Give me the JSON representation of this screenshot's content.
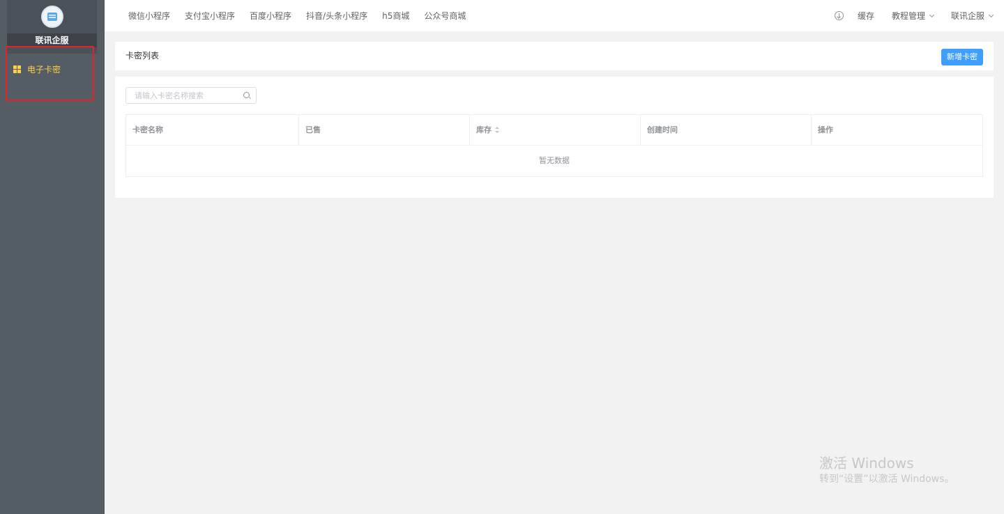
{
  "sidebar": {
    "brand_name": "联讯企服",
    "menu": [
      {
        "label": "电子卡密",
        "icon": "grid-icon",
        "active": true,
        "color": "#ffd04b"
      }
    ],
    "background": "#545c64",
    "highlight_color": "#e8202a"
  },
  "topnav": {
    "items": [
      "微信小程序",
      "支付宝小程序",
      "百度小程序",
      "抖音/头条小程序",
      "h5商城",
      "公众号商城"
    ],
    "right": {
      "download_icon": "download-circle-icon",
      "cache": "缓存",
      "tutorial": "教程管理",
      "user": "联讯企服"
    }
  },
  "card": {
    "title": "卡密列表",
    "add_button": "新增卡密",
    "search": {
      "placeholder": "请输入卡密名称搜索",
      "value": ""
    },
    "table": {
      "columns": [
        "卡密名称",
        "已售",
        "库存",
        "创建时间",
        "操作"
      ],
      "sortable_column": "库存",
      "rows": [],
      "empty_text": "暂无数据"
    }
  },
  "watermark": {
    "title": "激活 Windows",
    "subtitle": "转到“设置”以激活 Windows。"
  },
  "colors": {
    "primary": "#409eff",
    "page_bg": "#f2f2f2"
  }
}
